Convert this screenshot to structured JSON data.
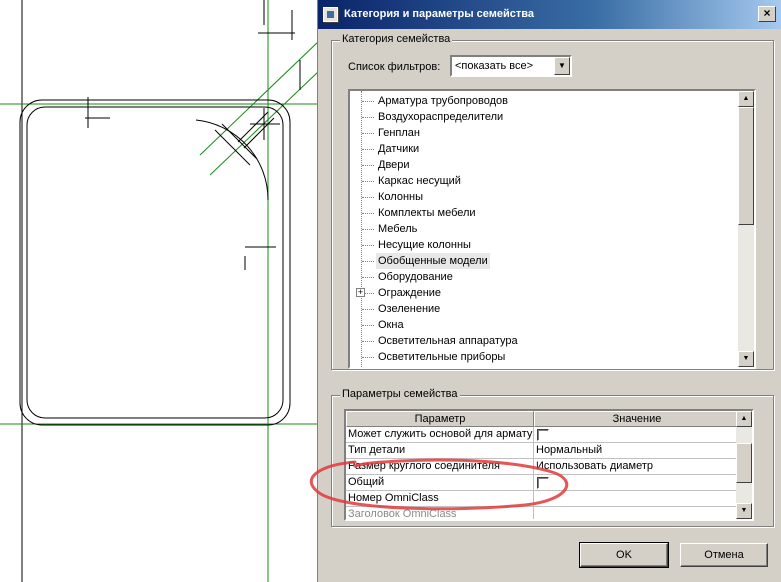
{
  "dialog": {
    "title": "Категория и параметры семейства",
    "close_glyph": "×"
  },
  "category": {
    "group_label": "Категория семейства",
    "filter_label": "Список фильтров:",
    "filter_value": "<показать все>",
    "filter_arrow": "▼",
    "items": [
      "Арматура трубопроводов",
      "Воздухораспределители",
      "Генплан",
      "Датчики",
      "Двери",
      "Каркас несущий",
      "Колонны",
      "Комплекты мебели",
      "Мебель",
      "Несущие колонны",
      "Обобщенные модели",
      "Оборудование",
      "Ограждение",
      "Озеленение",
      "Окна",
      "Осветительная аппаратура",
      "Осветительные приборы"
    ],
    "selected": "Обобщенные модели",
    "expandable": "Ограждение",
    "expander_glyph": "+"
  },
  "params": {
    "group_label": "Параметры семейства",
    "headers": [
      "Параметр",
      "Значение"
    ],
    "rows": [
      {
        "name": "Может служить основой для армату",
        "value": "",
        "checkbox": true
      },
      {
        "name": "Тип детали",
        "value": "Нормальный",
        "checkbox": false
      },
      {
        "name": "Размер круглого соединителя",
        "value": "Использовать диаметр",
        "checkbox": false
      },
      {
        "name": "Общий",
        "value": "",
        "checkbox": true
      },
      {
        "name": "Номер OmniClass",
        "value": "",
        "checkbox": false
      },
      {
        "name": "Заголовок OmniClass",
        "value": "",
        "checkbox": false,
        "disabled": true
      }
    ]
  },
  "buttons": {
    "ok": "OK",
    "cancel": "Отмена"
  },
  "scroll": {
    "up": "▲",
    "down": "▼"
  },
  "colors": {
    "titlebar_start": "#0a246a",
    "titlebar_end": "#a6caf0",
    "dialog_bg": "#d4d0c8",
    "cad_green": "#1a8a1a",
    "annotation_red": "#e03a3a"
  }
}
